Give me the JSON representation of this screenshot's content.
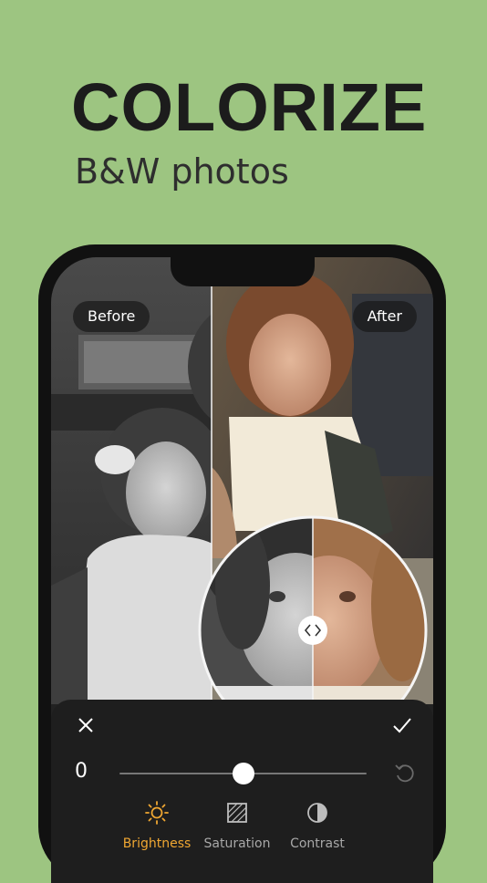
{
  "headline": {
    "title": "COLORIZE",
    "subtitle": "B&W photos"
  },
  "editor": {
    "before_label": "Before",
    "after_label": "After",
    "slider": {
      "value": "0",
      "level": 0.5
    },
    "tools": [
      {
        "label": "Brightness",
        "icon": "sun-icon",
        "active": true
      },
      {
        "label": "Saturation",
        "icon": "saturation-icon",
        "active": false
      },
      {
        "label": "Contrast",
        "icon": "contrast-icon",
        "active": false
      }
    ]
  },
  "colors": {
    "background": "#9dc581",
    "accent": "#f0a732",
    "panel": "#1e1e1e"
  }
}
